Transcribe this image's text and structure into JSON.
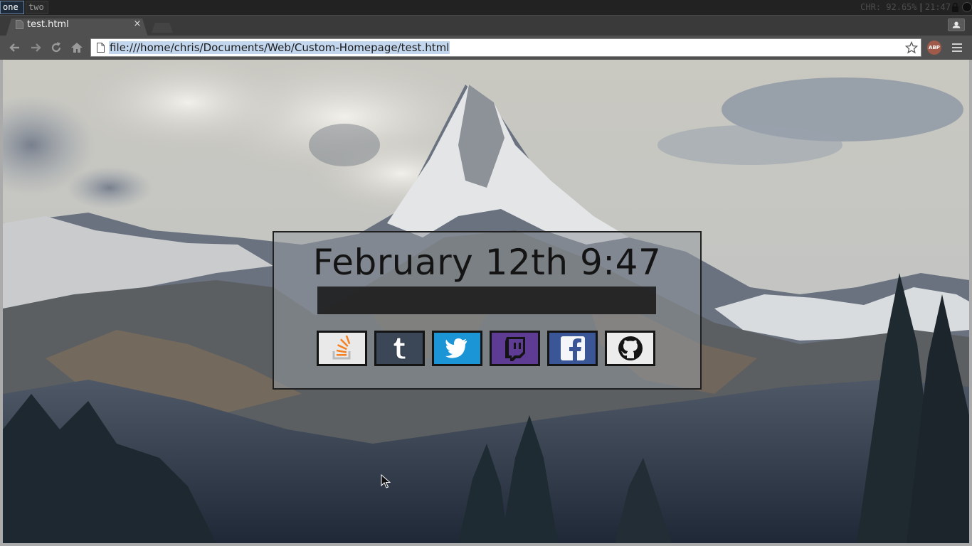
{
  "wm": {
    "workspaces": [
      {
        "label": "one",
        "active": true
      },
      {
        "label": "two",
        "active": false
      }
    ],
    "status_cpu": "CHR: 92.65%",
    "status_sep": "|",
    "status_time": "21:47"
  },
  "browser": {
    "tab_title": "test.html",
    "tab_close": "×",
    "url": "file:///home/chris/Documents/Web/Custom-Homepage/test.html",
    "abp_label": "ABP"
  },
  "page": {
    "clock": "February 12th 9:47",
    "search_value": "",
    "links": [
      {
        "name": "stackoverflow",
        "icon": "stackoverflow-icon",
        "color": "#e9e9e9"
      },
      {
        "name": "tumblr",
        "icon": "tumblr-icon",
        "color": "#3b4657"
      },
      {
        "name": "twitter",
        "icon": "twitter-icon",
        "color": "#1b95d6"
      },
      {
        "name": "twitch",
        "icon": "twitch-icon",
        "color": "#5f3c94"
      },
      {
        "name": "facebook",
        "icon": "facebook-icon",
        "color": "#3a5697"
      },
      {
        "name": "github",
        "icon": "github-icon",
        "color": "#ececec"
      }
    ]
  }
}
